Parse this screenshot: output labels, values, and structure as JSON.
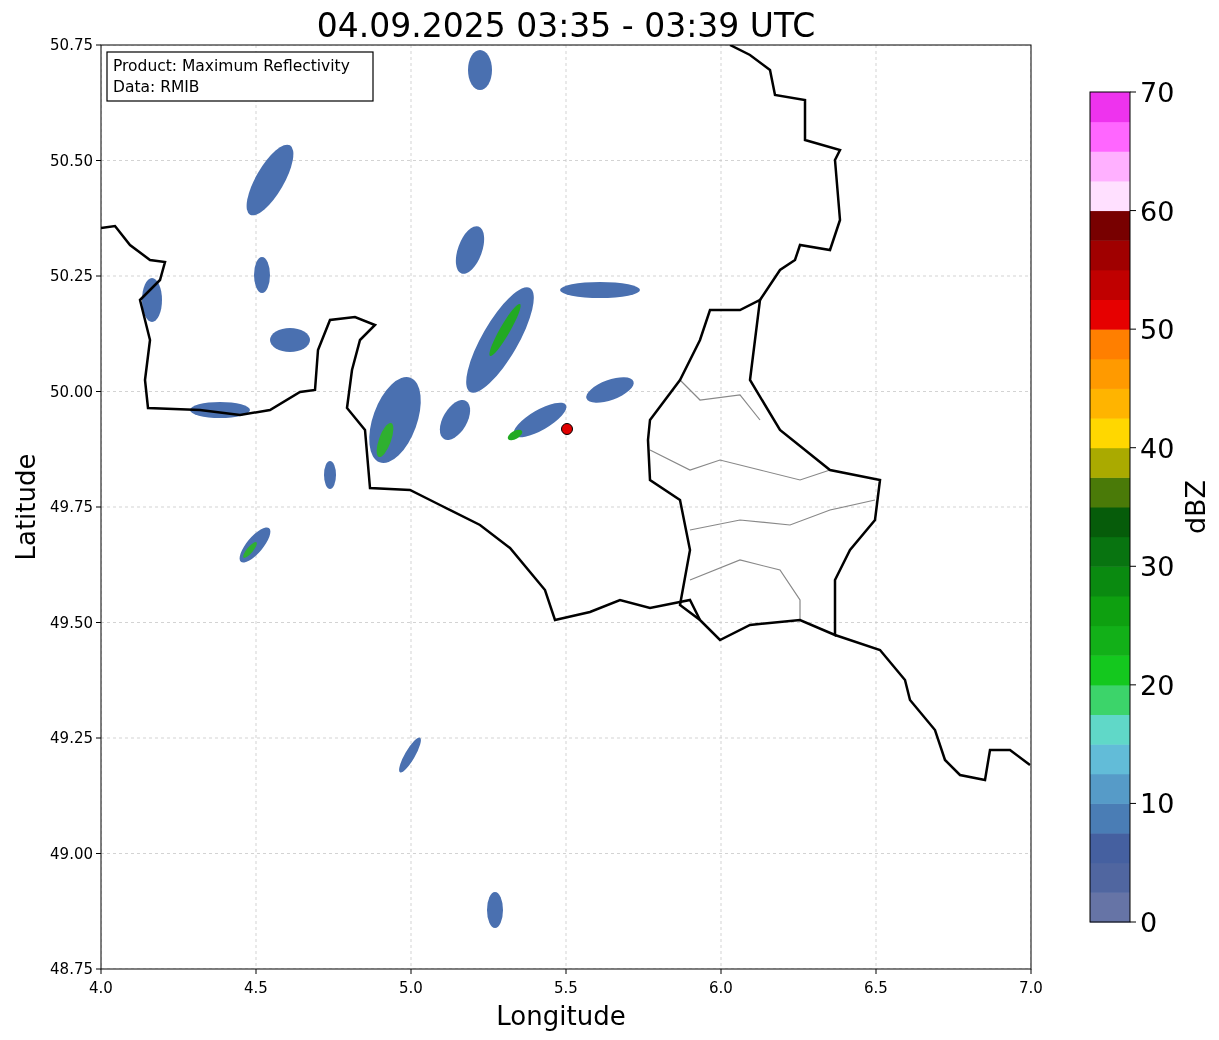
{
  "title": "04.09.2025 03:35 - 03:39 UTC",
  "map": {
    "legend": [
      "Product: Maximum Reflectivity",
      "Data: RMIB"
    ],
    "xlabel": "Longitude",
    "ylabel": "Latitude",
    "xticks": [
      "4.0",
      "4.5",
      "5.0",
      "5.5",
      "6.0",
      "6.5",
      "7.0"
    ],
    "yticks": [
      "50.75",
      "50.50",
      "50.25",
      "50.00",
      "49.75",
      "49.50",
      "49.25",
      "49.00",
      "48.75"
    ]
  },
  "colorbar": {
    "label": "dBZ",
    "ticks": [
      "70",
      "60",
      "50",
      "40",
      "30",
      "20",
      "10",
      "0"
    ],
    "bands": [
      {
        "color": "#6674a6"
      },
      {
        "color": "#5066a0"
      },
      {
        "color": "#4560a0"
      },
      {
        "color": "#4a7db5"
      },
      {
        "color": "#569bc8"
      },
      {
        "color": "#62bcd8"
      },
      {
        "color": "#60d8c8"
      },
      {
        "color": "#3cd46a"
      },
      {
        "color": "#14c81e"
      },
      {
        "color": "#12b018"
      },
      {
        "color": "#0ea010"
      },
      {
        "color": "#0a8a10"
      },
      {
        "color": "#087410"
      },
      {
        "color": "#065c0a"
      },
      {
        "color": "#4a7a08"
      },
      {
        "color": "#aaaa00"
      },
      {
        "color": "#ffd700"
      },
      {
        "color": "#ffb400"
      },
      {
        "color": "#ff9a00"
      },
      {
        "color": "#ff7f00"
      },
      {
        "color": "#e60000"
      },
      {
        "color": "#c00000"
      },
      {
        "color": "#a00000"
      },
      {
        "color": "#780000"
      },
      {
        "color": "#ffe0ff"
      },
      {
        "color": "#ffb0ff"
      },
      {
        "color": "#ff66ff"
      },
      {
        "color": "#ee33ee"
      }
    ]
  }
}
